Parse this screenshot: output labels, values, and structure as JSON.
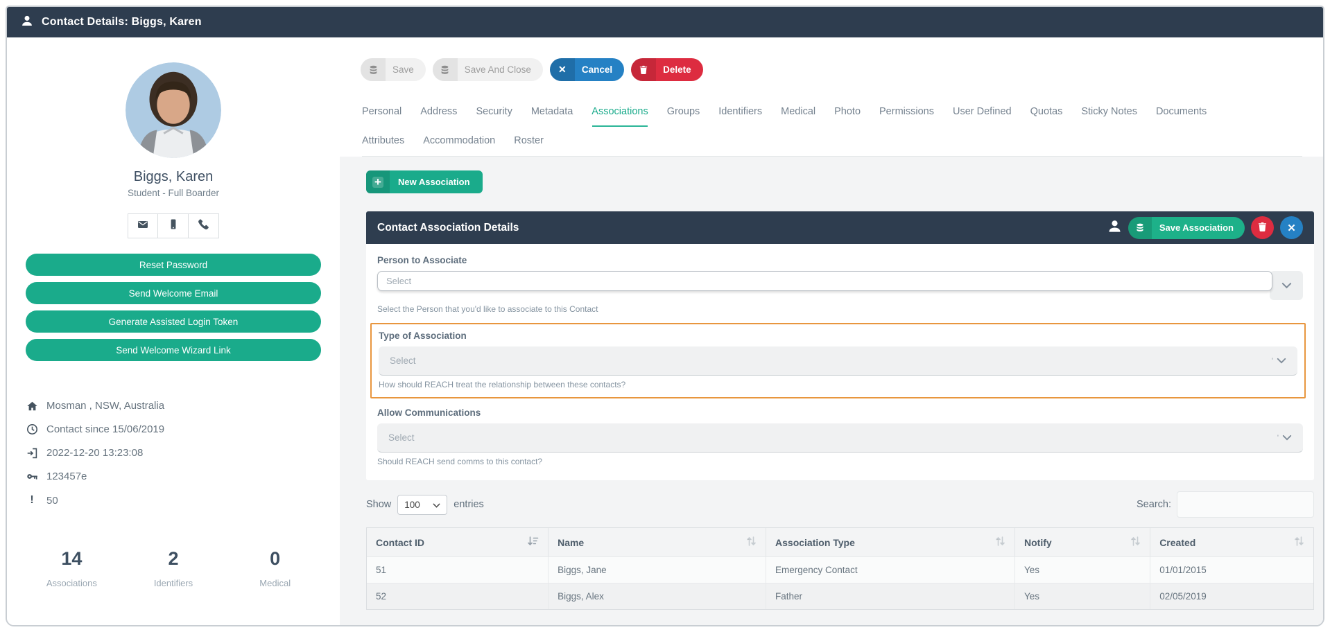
{
  "colors": {
    "navy": "#2e3d4f",
    "teal": "#1aab8b",
    "blue": "#2581c4",
    "red": "#dd2c40",
    "orange_highlight": "#e8963e",
    "content_bg": "#f3f4f5"
  },
  "window": {
    "title": "Contact Details: Biggs, Karen"
  },
  "toolbar": {
    "save": "Save",
    "save_and_close": "Save And Close",
    "cancel": "Cancel",
    "delete": "Delete"
  },
  "tabs": {
    "active": "Associations",
    "row1": [
      "Personal",
      "Address",
      "Security",
      "Metadata",
      "Associations",
      "Groups",
      "Identifiers",
      "Medical",
      "Photo",
      "Permissions",
      "User Defined",
      "Quotas",
      "Sticky Notes",
      "Documents"
    ],
    "row2": [
      "Attributes",
      "Accommodation",
      "Roster"
    ]
  },
  "profile": {
    "name": "Biggs, Karen",
    "role": "Student - Full Boarder",
    "buttons": [
      "Reset Password",
      "Send Welcome Email",
      "Generate Assisted Login Token",
      "Send Welcome Wizard Link"
    ],
    "info": [
      {
        "icon": "home-icon",
        "text": "Mosman , NSW, Australia"
      },
      {
        "icon": "clock-icon",
        "text": "Contact since 15/06/2019"
      },
      {
        "icon": "sign-in-icon",
        "text": "2022-12-20 13:23:08"
      },
      {
        "icon": "key-icon",
        "text": "123457e"
      },
      {
        "icon": "exclamation-icon",
        "text": "50"
      }
    ],
    "stats": [
      {
        "value": "14",
        "label": "Associations"
      },
      {
        "value": "2",
        "label": "Identifiers"
      },
      {
        "value": "0",
        "label": "Medical"
      }
    ]
  },
  "assoc": {
    "new_button": "New Association"
  },
  "panel": {
    "title": "Contact Association Details",
    "save": "Save Association",
    "fields": {
      "person": {
        "label": "Person to Associate",
        "placeholder": "Select",
        "help": "Select the Person that you'd like to associate to this Contact"
      },
      "type": {
        "label": "Type of Association",
        "placeholder": "Select",
        "help": "How should REACH treat the relationship between these contacts?"
      },
      "comms": {
        "label": "Allow Communications",
        "placeholder": "Select",
        "help": "Should REACH send comms to this contact?"
      }
    }
  },
  "tablebar": {
    "show": "Show",
    "page_size": "100",
    "entries": "entries",
    "search": "Search:"
  },
  "table": {
    "headers": [
      "Contact ID",
      "Name",
      "Association Type",
      "Notify",
      "Created"
    ],
    "rows": [
      [
        "51",
        "Biggs, Jane",
        "Emergency Contact",
        "Yes",
        "01/01/2015"
      ],
      [
        "52",
        "Biggs, Alex",
        "Father",
        "Yes",
        "02/05/2019"
      ]
    ]
  }
}
